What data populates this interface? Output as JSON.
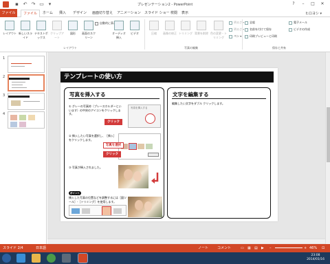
{
  "window": {
    "title": "プレゼンテーション2 - PowerPoint",
    "user": "ヒロヨシ ▾"
  },
  "tabs": [
    "ファイル",
    "ファイル",
    "ホーム",
    "挿入",
    "デザイン",
    "画面切り替え",
    "アニメーション",
    "スライド ショー",
    "校閲",
    "表示"
  ],
  "ribbon": {
    "layout": "レイアウト",
    "new_slide": "新しいスライド",
    "textbox": "テキストボックス",
    "clipart": "クリップアート",
    "shapes": "図形",
    "screenshot": "画面のスクリーン",
    "auto_show": "自動的に表示",
    "audio": "オーディオ挿入",
    "video": "ビデオ",
    "group_layout": "レイアウト",
    "photo_edit_items": [
      "圧縮",
      "画像の修正",
      "トリミング",
      "背景を削除",
      "色の変更・トリミング"
    ],
    "small_items": [
      "明るさ ▾",
      "明るさ ▾",
      "ペン ▾"
    ],
    "group_photo_edit": "写真の編集",
    "save_items": [
      "全般",
      "名前を付けて保存",
      "印刷プレビューと印刷"
    ],
    "save_items_right": [
      "電子メール",
      "ビデオの作成"
    ],
    "group_save_share": "保存と共有"
  },
  "thumbnails": [
    "1",
    "2",
    "3",
    "4"
  ],
  "slide": {
    "title": "テンプレートの使い方",
    "left_panel": {
      "heading": "写真を挿入する",
      "step1": "① グレーの写真枠（プレースホルダーといいます）の中央のアイコンをクリックします。",
      "screenshot1_label": "写真を挿入する",
      "callout1": "クリック",
      "step2": "② 挿入したい写真を選択し、［挿入］をクリックします。",
      "callout2": "写真を選択",
      "callout3": "クリック",
      "step3": "③ 写真が挿入されました。",
      "point_badge": "ポイント",
      "tip": "挿入した写真の位置などを調整するには［図ツール］-［トリミング］を使用します。"
    },
    "right_panel": {
      "heading": "文字を編集する",
      "body": "編集したい文字をダブル クリックします。"
    }
  },
  "status": {
    "slide": "スライド 2/4",
    "lang": "日本語",
    "notes": "ノート",
    "comments": "コメント",
    "zoom": "46%"
  },
  "clock": {
    "time": "23:08",
    "date": "2014/01/16"
  },
  "colors": {
    "accent": "#d24726",
    "callout": "#d23a3a",
    "taskbar": "#1e3a5c"
  }
}
